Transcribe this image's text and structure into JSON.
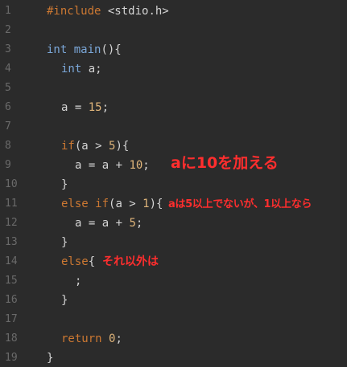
{
  "editor": {
    "line_numbers": [
      "1",
      "2",
      "3",
      "4",
      "5",
      "6",
      "7",
      "8",
      "9",
      "10",
      "11",
      "12",
      "13",
      "14",
      "15",
      "16",
      "17",
      "18",
      "19"
    ],
    "lines": {
      "l1": {
        "kw": "#include",
        "rest": " <stdio.h>"
      },
      "l3": {
        "type": "int",
        "fn": "main",
        "rest": "(){"
      },
      "l4": {
        "type": "int",
        "rest": " a;"
      },
      "l6": {
        "pre": "a = ",
        "num": "15",
        "post": ";"
      },
      "l8": {
        "kw": "if",
        "pre": "(a > ",
        "num": "5",
        "post": "){"
      },
      "l9": {
        "pre": "a = a + ",
        "num": "10",
        "post": ";"
      },
      "l10": {
        "text": "}"
      },
      "l11": {
        "kw": "else if",
        "pre": "(a > ",
        "num": "1",
        "post": "){"
      },
      "l12": {
        "pre": "a = a + ",
        "num": "5",
        "post": ";"
      },
      "l13": {
        "text": "}"
      },
      "l14": {
        "kw": "else",
        "post": "{"
      },
      "l15": {
        "text": ";"
      },
      "l16": {
        "text": "}"
      },
      "l18": {
        "kw": "return",
        "num": "0",
        "post": ";"
      },
      "l19": {
        "text": "}"
      }
    }
  },
  "annotations": {
    "a1": "aに10を加える",
    "a2": "aは5以上でないが、1以上なら",
    "a3": "それ以外は"
  },
  "colors": {
    "background": "#2b2b2b",
    "annotation": "#ff2e2e"
  }
}
